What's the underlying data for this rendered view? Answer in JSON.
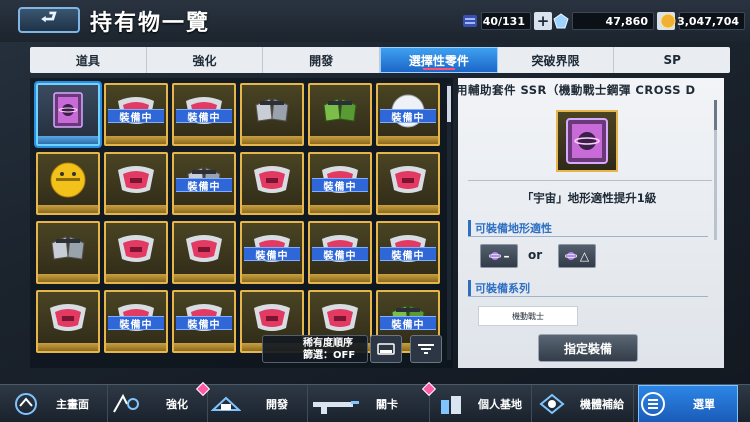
{
  "header": {
    "back_label": "⮐",
    "title": "持有物一覽",
    "capacity": "40/131",
    "currency_1": "47,860",
    "currency_2": "3,047,704",
    "plus": "+"
  },
  "tabs": [
    {
      "label": "道具"
    },
    {
      "label": "強化"
    },
    {
      "label": "開發"
    },
    {
      "label": "選擇性零件",
      "active": true
    },
    {
      "label": "突破界限"
    },
    {
      "label": "SP"
    }
  ],
  "grid": {
    "badge_label": "裝備中",
    "rows": [
      [
        {
          "item": "pink-chip",
          "equipped": false,
          "selected": true
        },
        {
          "item": "red-armor",
          "equipped": true
        },
        {
          "item": "red-armor",
          "equipped": true
        },
        {
          "item": "grey-boots",
          "equipped": false
        },
        {
          "item": "green-boots",
          "equipped": false
        },
        {
          "item": "white-haro",
          "equipped": true
        }
      ],
      [
        {
          "item": "yellow-haro",
          "equipped": false
        },
        {
          "item": "red-armor",
          "equipped": false
        },
        {
          "item": "grey-boots",
          "equipped": true
        },
        {
          "item": "red-armor",
          "equipped": false
        },
        {
          "item": "red-armor",
          "equipped": true
        },
        {
          "item": "red-armor",
          "equipped": false
        }
      ],
      [
        {
          "item": "grey-boots",
          "equipped": false
        },
        {
          "item": "red-armor",
          "equipped": false
        },
        {
          "item": "red-armor",
          "equipped": false
        },
        {
          "item": "red-armor",
          "equipped": true
        },
        {
          "item": "red-armor",
          "equipped": true
        },
        {
          "item": "red-armor",
          "equipped": true
        }
      ],
      [
        {
          "item": "red-armor",
          "equipped": false
        },
        {
          "item": "red-armor",
          "equipped": true
        },
        {
          "item": "red-armor",
          "equipped": true
        },
        {
          "item": "red-armor",
          "equipped": false
        },
        {
          "item": "red-armor",
          "equipped": false
        },
        {
          "item": "green-boots",
          "equipped": true
        }
      ]
    ]
  },
  "sort": {
    "order_label": "稀有度順序",
    "filter_label": "篩選：OFF"
  },
  "detail": {
    "title": "宙用輔助套件 SSR（機動戰士鋼彈 CROSS D",
    "description": "「宇宙」地形適性提升1級",
    "terrain_section": "可裝備地形適性",
    "terrain_option_1": "–",
    "terrain_option_2": "△",
    "or_label": "or",
    "series_section": "可裝備系列",
    "series_tag": "機動戰士",
    "equip_button": "指定裝備"
  },
  "bottom_nav": [
    {
      "label": "主畫面",
      "icon": "home-icon",
      "badge": false
    },
    {
      "label": "強化",
      "icon": "enhance-icon",
      "badge": true
    },
    {
      "label": "開發",
      "icon": "develop-icon",
      "badge": false
    },
    {
      "label": "關卡",
      "icon": "stage-icon",
      "badge": true
    },
    {
      "label": "個人基地",
      "icon": "base-icon",
      "badge": false
    },
    {
      "label": "機體補給",
      "icon": "supply-icon",
      "badge": false
    },
    {
      "label": "選單",
      "icon": "menu-icon",
      "badge": false,
      "active": true
    }
  ],
  "colors": {
    "accent": "#1b66c8",
    "gold": "#e7b64a",
    "equipped_badge": "#2f66d8",
    "notify": "#ff5aa8"
  }
}
